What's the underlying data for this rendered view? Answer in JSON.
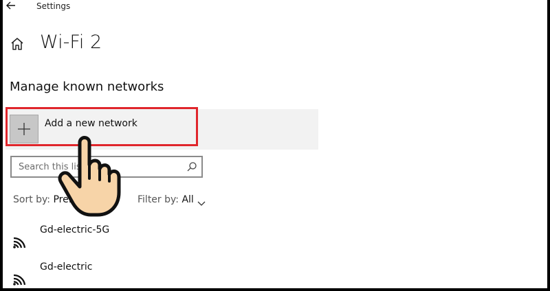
{
  "app": {
    "title": "Settings"
  },
  "page": {
    "title": "Wi-Fi 2"
  },
  "section": {
    "title": "Manage known networks"
  },
  "add_network": {
    "label": "Add a new network"
  },
  "search": {
    "placeholder": "Search this list",
    "value": ""
  },
  "sort": {
    "label": "Sort by:",
    "value": "Preference"
  },
  "filter": {
    "label": "Filter by:",
    "value": "All"
  },
  "networks": [
    {
      "name": "Gd-electric-5G",
      "icon": "wifi-icon"
    },
    {
      "name": "Gd-electric",
      "icon": "wifi-icon"
    }
  ],
  "colors": {
    "highlight": "#e0252b",
    "add_row_bg": "#f2f2f2",
    "plus_box_bg": "#c7c7c7",
    "hand_fill": "#f7d4a8"
  }
}
